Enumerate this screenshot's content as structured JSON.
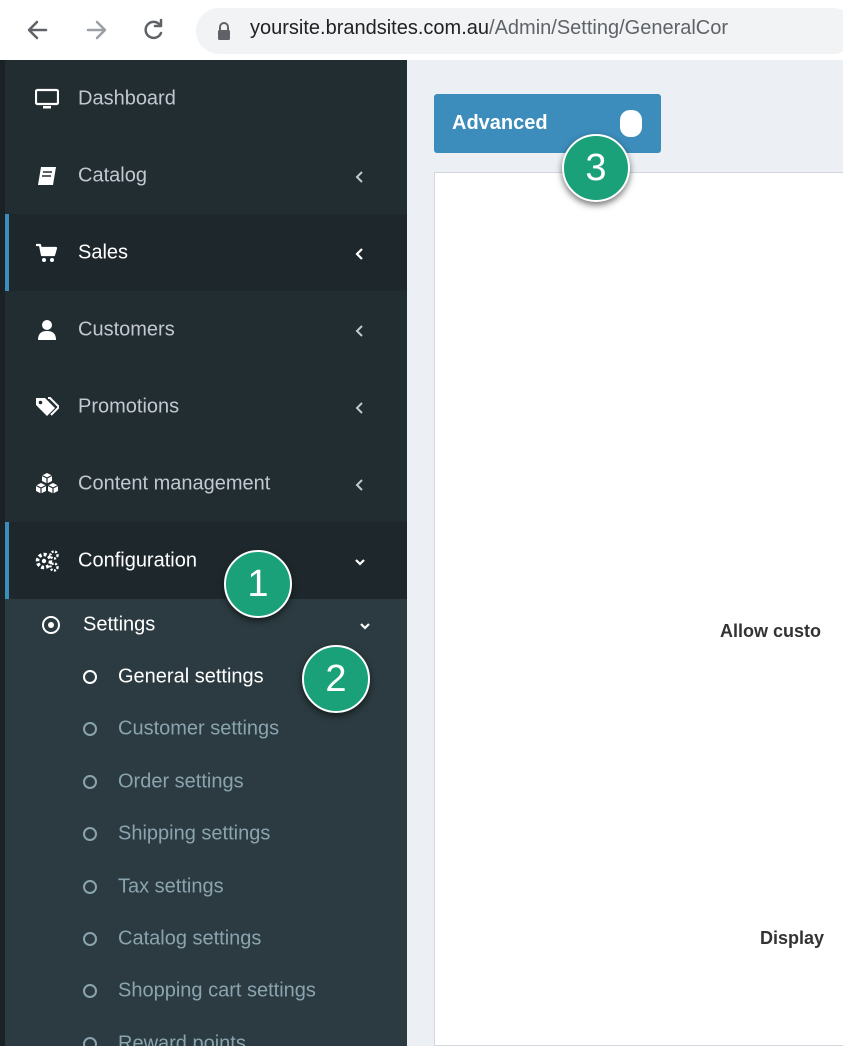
{
  "browser": {
    "url_host": "yoursite.brandsites.com.au",
    "url_path": "/Admin/Setting/GeneralCor"
  },
  "sidebar": {
    "items": [
      {
        "label": "Dashboard",
        "icon": "monitor-icon"
      },
      {
        "label": "Catalog",
        "icon": "book-icon"
      },
      {
        "label": "Sales",
        "icon": "cart-icon"
      },
      {
        "label": "Customers",
        "icon": "user-icon"
      },
      {
        "label": "Promotions",
        "icon": "tags-icon"
      },
      {
        "label": "Content management",
        "icon": "cubes-icon"
      },
      {
        "label": "Configuration",
        "icon": "gears-icon"
      }
    ],
    "settings": {
      "label": "Settings"
    },
    "sub_items": [
      {
        "label": "General settings"
      },
      {
        "label": "Customer settings"
      },
      {
        "label": "Order settings"
      },
      {
        "label": "Shipping settings"
      },
      {
        "label": "Tax settings"
      },
      {
        "label": "Catalog settings"
      },
      {
        "label": "Shopping cart settings"
      },
      {
        "label": "Reward points"
      }
    ]
  },
  "main": {
    "advanced_label": "Advanced",
    "field_labels": [
      "Allow custo",
      "Display"
    ]
  },
  "badges": [
    "1",
    "2",
    "3"
  ],
  "colors": {
    "sidebar_bg": "#2c3b41",
    "menu_bg": "#222d32",
    "active_bg": "#1e282c",
    "accent": "#3c8dbc",
    "badge": "#1aa179",
    "content_bg": "#ecf0f5"
  }
}
